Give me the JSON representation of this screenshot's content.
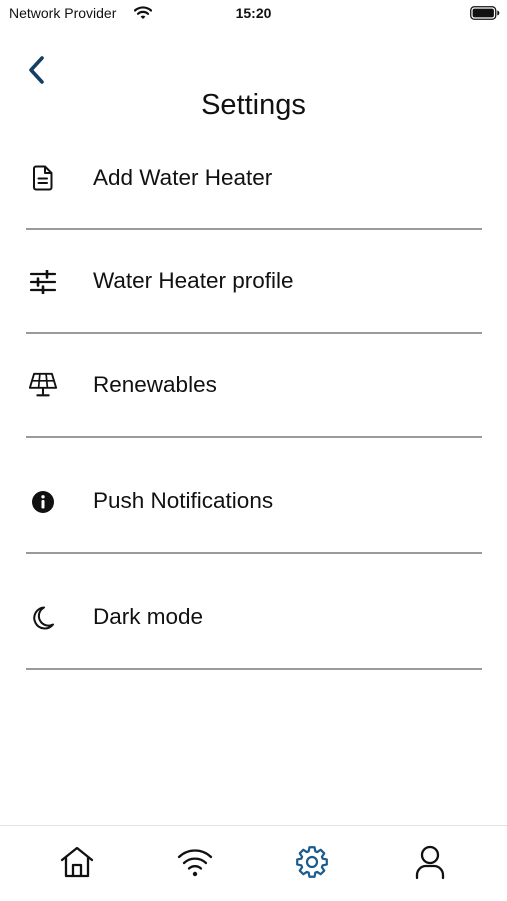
{
  "status_bar": {
    "carrier": "Network Provider",
    "time": "15:20",
    "wifi_icon": "wifi-icon",
    "battery_icon": "battery-full-icon"
  },
  "header": {
    "title": "Settings",
    "back_icon": "chevron-left-icon"
  },
  "settings": {
    "items": [
      {
        "label": "Add Water Heater",
        "icon": "document-icon"
      },
      {
        "label": "Water Heater profile",
        "icon": "sliders-icon"
      },
      {
        "label": "Renewables",
        "icon": "solar-panel-icon"
      },
      {
        "label": "Push Notifications",
        "icon": "info-icon"
      },
      {
        "label": "Dark mode",
        "icon": "moon-icon"
      }
    ]
  },
  "tab_bar": {
    "tabs": [
      {
        "icon": "home-icon",
        "active": false
      },
      {
        "icon": "wifi-icon",
        "active": false
      },
      {
        "icon": "gear-icon",
        "active": true
      },
      {
        "icon": "user-icon",
        "active": false
      }
    ]
  },
  "colors": {
    "accent": "#1b5a8c",
    "back_arrow": "#163f66",
    "text": "#111111",
    "divider": "#9a9a9a"
  }
}
